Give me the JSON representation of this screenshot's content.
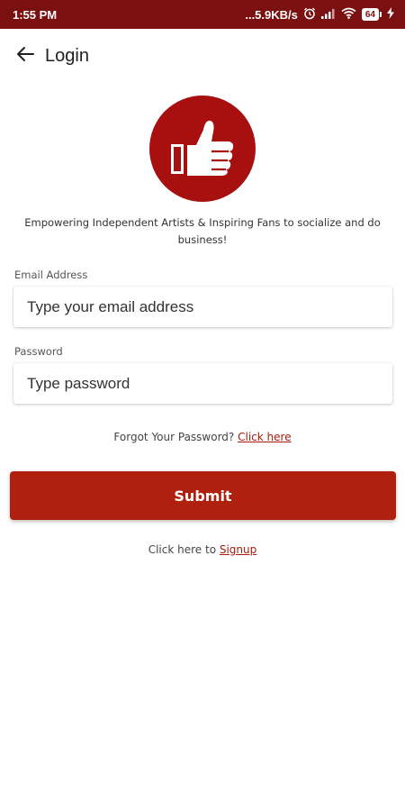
{
  "status_bar": {
    "time": "1:55 PM",
    "net_speed": "...5.9KB/s",
    "battery": "64"
  },
  "app_bar": {
    "title": "Login"
  },
  "brand": {
    "tagline": "Empowering Independent Artists & Inspiring Fans to socialize and do business!",
    "accent_color": "#a81010"
  },
  "form": {
    "email_label": "Email Address",
    "email_placeholder": "Type your email address",
    "email_value": "",
    "password_label": "Password",
    "password_placeholder": "Type password",
    "password_value": ""
  },
  "forgot": {
    "text": "Forgot Your Password?",
    "link": "Click here"
  },
  "submit_label": "Submit",
  "signup": {
    "text": "Click here to",
    "link": "Signup"
  },
  "icons": [
    "back-arrow-icon",
    "thumbs-up-icon",
    "alarm-icon",
    "signal-icon",
    "wifi-icon",
    "battery-icon",
    "charging-icon"
  ]
}
